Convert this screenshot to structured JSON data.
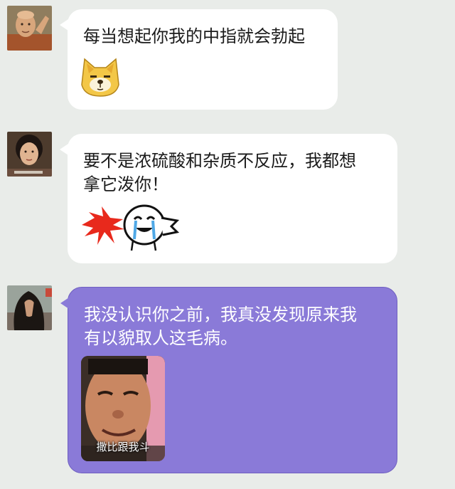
{
  "chat": {
    "background_color": "#e9ece9",
    "bubble_color_incoming": "#ffffff",
    "bubble_color_highlight": "#8a7ad8",
    "messages": [
      {
        "avatar_icon": "monk-avatar",
        "text": "每当想起你我的中指就会勃起",
        "sticker_icon": "doge-emoji-icon"
      },
      {
        "avatar_icon": "woman-avatar",
        "text": "要不是浓硫酸和杂质不反应，我都想\n拿它泼你！",
        "sticker_icon": "splash-crying-face-icon"
      },
      {
        "avatar_icon": "long-hair-avatar",
        "text": "我没认识你之前，我真没发现原来我\n有以貌取人这毛病。",
        "meme_caption": "撒比跟我斗"
      }
    ]
  }
}
